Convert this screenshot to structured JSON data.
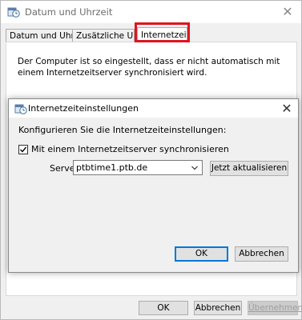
{
  "window": {
    "title": "Datum und Uhrzeit",
    "icon": "clock-calendar-icon",
    "close_glyph": "✕",
    "tabs": [
      {
        "label": "Datum und Uhrzeit",
        "active": false
      },
      {
        "label": "Zusätzliche Uhren",
        "active": false
      },
      {
        "label": "Internetzeit",
        "active": true
      }
    ],
    "highlight_color": "#e0141e",
    "panel_text": "Der Computer ist so eingestellt, dass er nicht automatisch mit einem Internetzeitserver synchronisiert wird.",
    "buttons": {
      "ok": "OK",
      "cancel": "Abbrechen",
      "apply": "Übernehmen",
      "apply_enabled": false
    }
  },
  "dialog": {
    "title": "Internetzeiteinstellungen",
    "icon": "clock-calendar-icon",
    "close_glyph": "✕",
    "instructions": "Konfigurieren Sie die Internetzeiteinstellungen:",
    "sync_checkbox": {
      "label": "Mit einem Internetzeitserver synchronisieren",
      "checked": true
    },
    "server": {
      "label": "Server:",
      "value": "ptbtime1.ptb.de"
    },
    "update_button": "Jetzt aktualisieren",
    "ok_button": "OK",
    "cancel_button": "Abbrechen"
  }
}
